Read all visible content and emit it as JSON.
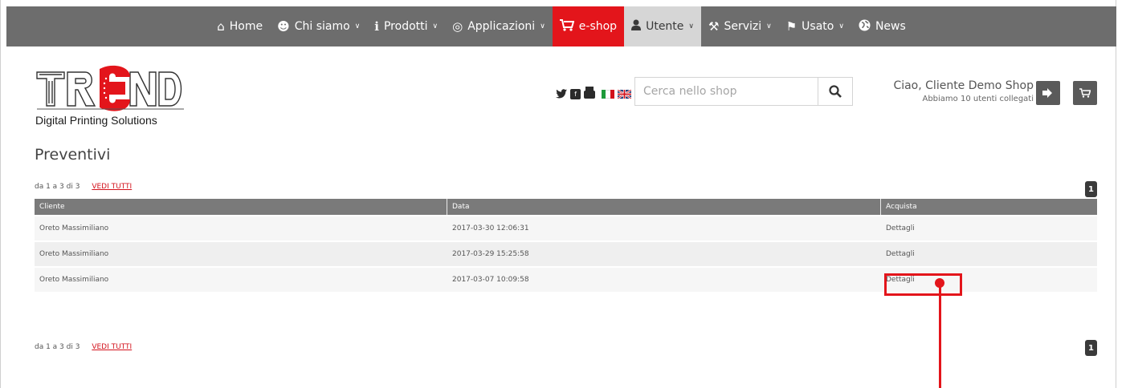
{
  "nav": {
    "items": [
      {
        "label": "Home",
        "icon": "home-icon",
        "glyph": "⌂",
        "chevron": false
      },
      {
        "label": "Chi siamo",
        "icon": "group-icon",
        "glyph": "☻",
        "chevron": true
      },
      {
        "label": "Prodotti",
        "icon": "info-icon",
        "glyph": "ℹ",
        "chevron": true
      },
      {
        "label": "Applicazioni",
        "icon": "target-icon",
        "glyph": "◎",
        "chevron": true
      },
      {
        "label": "e-shop",
        "icon": "cart-icon",
        "glyph": "🛒",
        "chevron": false
      },
      {
        "label": "Utente",
        "icon": "user-icon",
        "glyph": "♟",
        "chevron": true
      },
      {
        "label": "Servizi",
        "icon": "wrench-icon",
        "glyph": "⚒",
        "chevron": true
      },
      {
        "label": "Usato",
        "icon": "megaphone-icon",
        "glyph": "⚑",
        "chevron": true
      },
      {
        "label": "News",
        "icon": "globe-icon",
        "glyph": "◉",
        "chevron": false
      }
    ],
    "chevron_glyph": "⌵"
  },
  "logo": {
    "brand": "TREND",
    "tagline": "Digital Printing Solutions"
  },
  "social": {
    "icons": [
      "twitter-icon",
      "facebook-icon",
      "youtube-icon"
    ],
    "youtube_label": "You Tube"
  },
  "search": {
    "placeholder": "Cerca nello shop"
  },
  "user": {
    "greeting": "Ciao, Cliente Demo Shop",
    "status": "Abbiamo 10 utenti collegati"
  },
  "page": {
    "title": "Preventivi"
  },
  "pagination": {
    "range_text": "da 1 a 3 di 3",
    "view_all": "VEDI TUTTI",
    "page_number": "1"
  },
  "table": {
    "headers": [
      "Cliente",
      "Data",
      "Acquista"
    ],
    "rows": [
      [
        "Oreto Massimiliano",
        "2017-03-30 12:06:31",
        "Dettagli"
      ],
      [
        "Oreto Massimiliano",
        "2017-03-29 15:25:58",
        "Dettagli"
      ],
      [
        "Oreto Massimiliano",
        "2017-03-07 10:09:58",
        "Dettagli"
      ]
    ]
  },
  "colors": {
    "nav_bg": "#6d6d6d",
    "accent_red": "#e3151b",
    "active_nav": "#d6d6d6",
    "table_header": "#7a7a7a"
  }
}
